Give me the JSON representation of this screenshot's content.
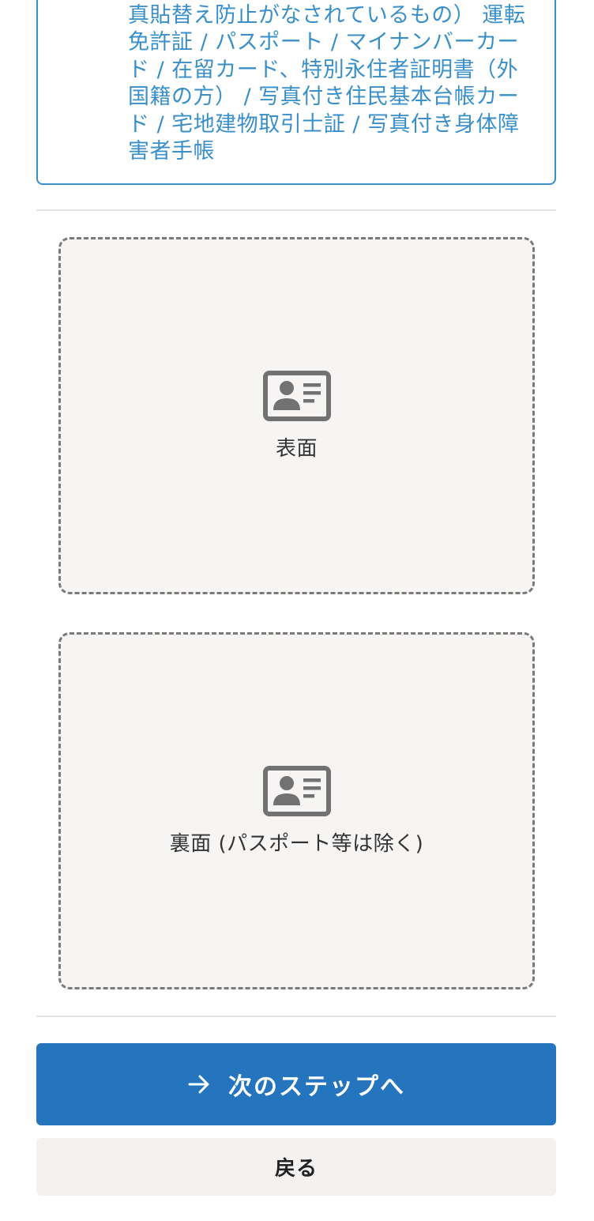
{
  "info": {
    "text": "提示できる身分証は以下の通りです（写真貼替え防止がなされているもの） 運転免許証 / パスポート / マイナンバーカード / 在留カード、特別永住者証明書（外国籍の方） / 写真付き住民基本台帳カード / 宅地建物取引士証 / 写真付き身体障害者手帳"
  },
  "uploads": {
    "front": {
      "label": "表面",
      "icon": "id-card-icon"
    },
    "back": {
      "label": "裏面 (パスポート等は除く)",
      "icon": "id-card-icon"
    }
  },
  "actions": {
    "next_label": "次のステップへ",
    "next_icon": "arrow-right-icon",
    "back_label": "戻る"
  },
  "colors": {
    "accent": "#2475bd",
    "info_text": "#3a8fc9",
    "icon": "#727272"
  }
}
